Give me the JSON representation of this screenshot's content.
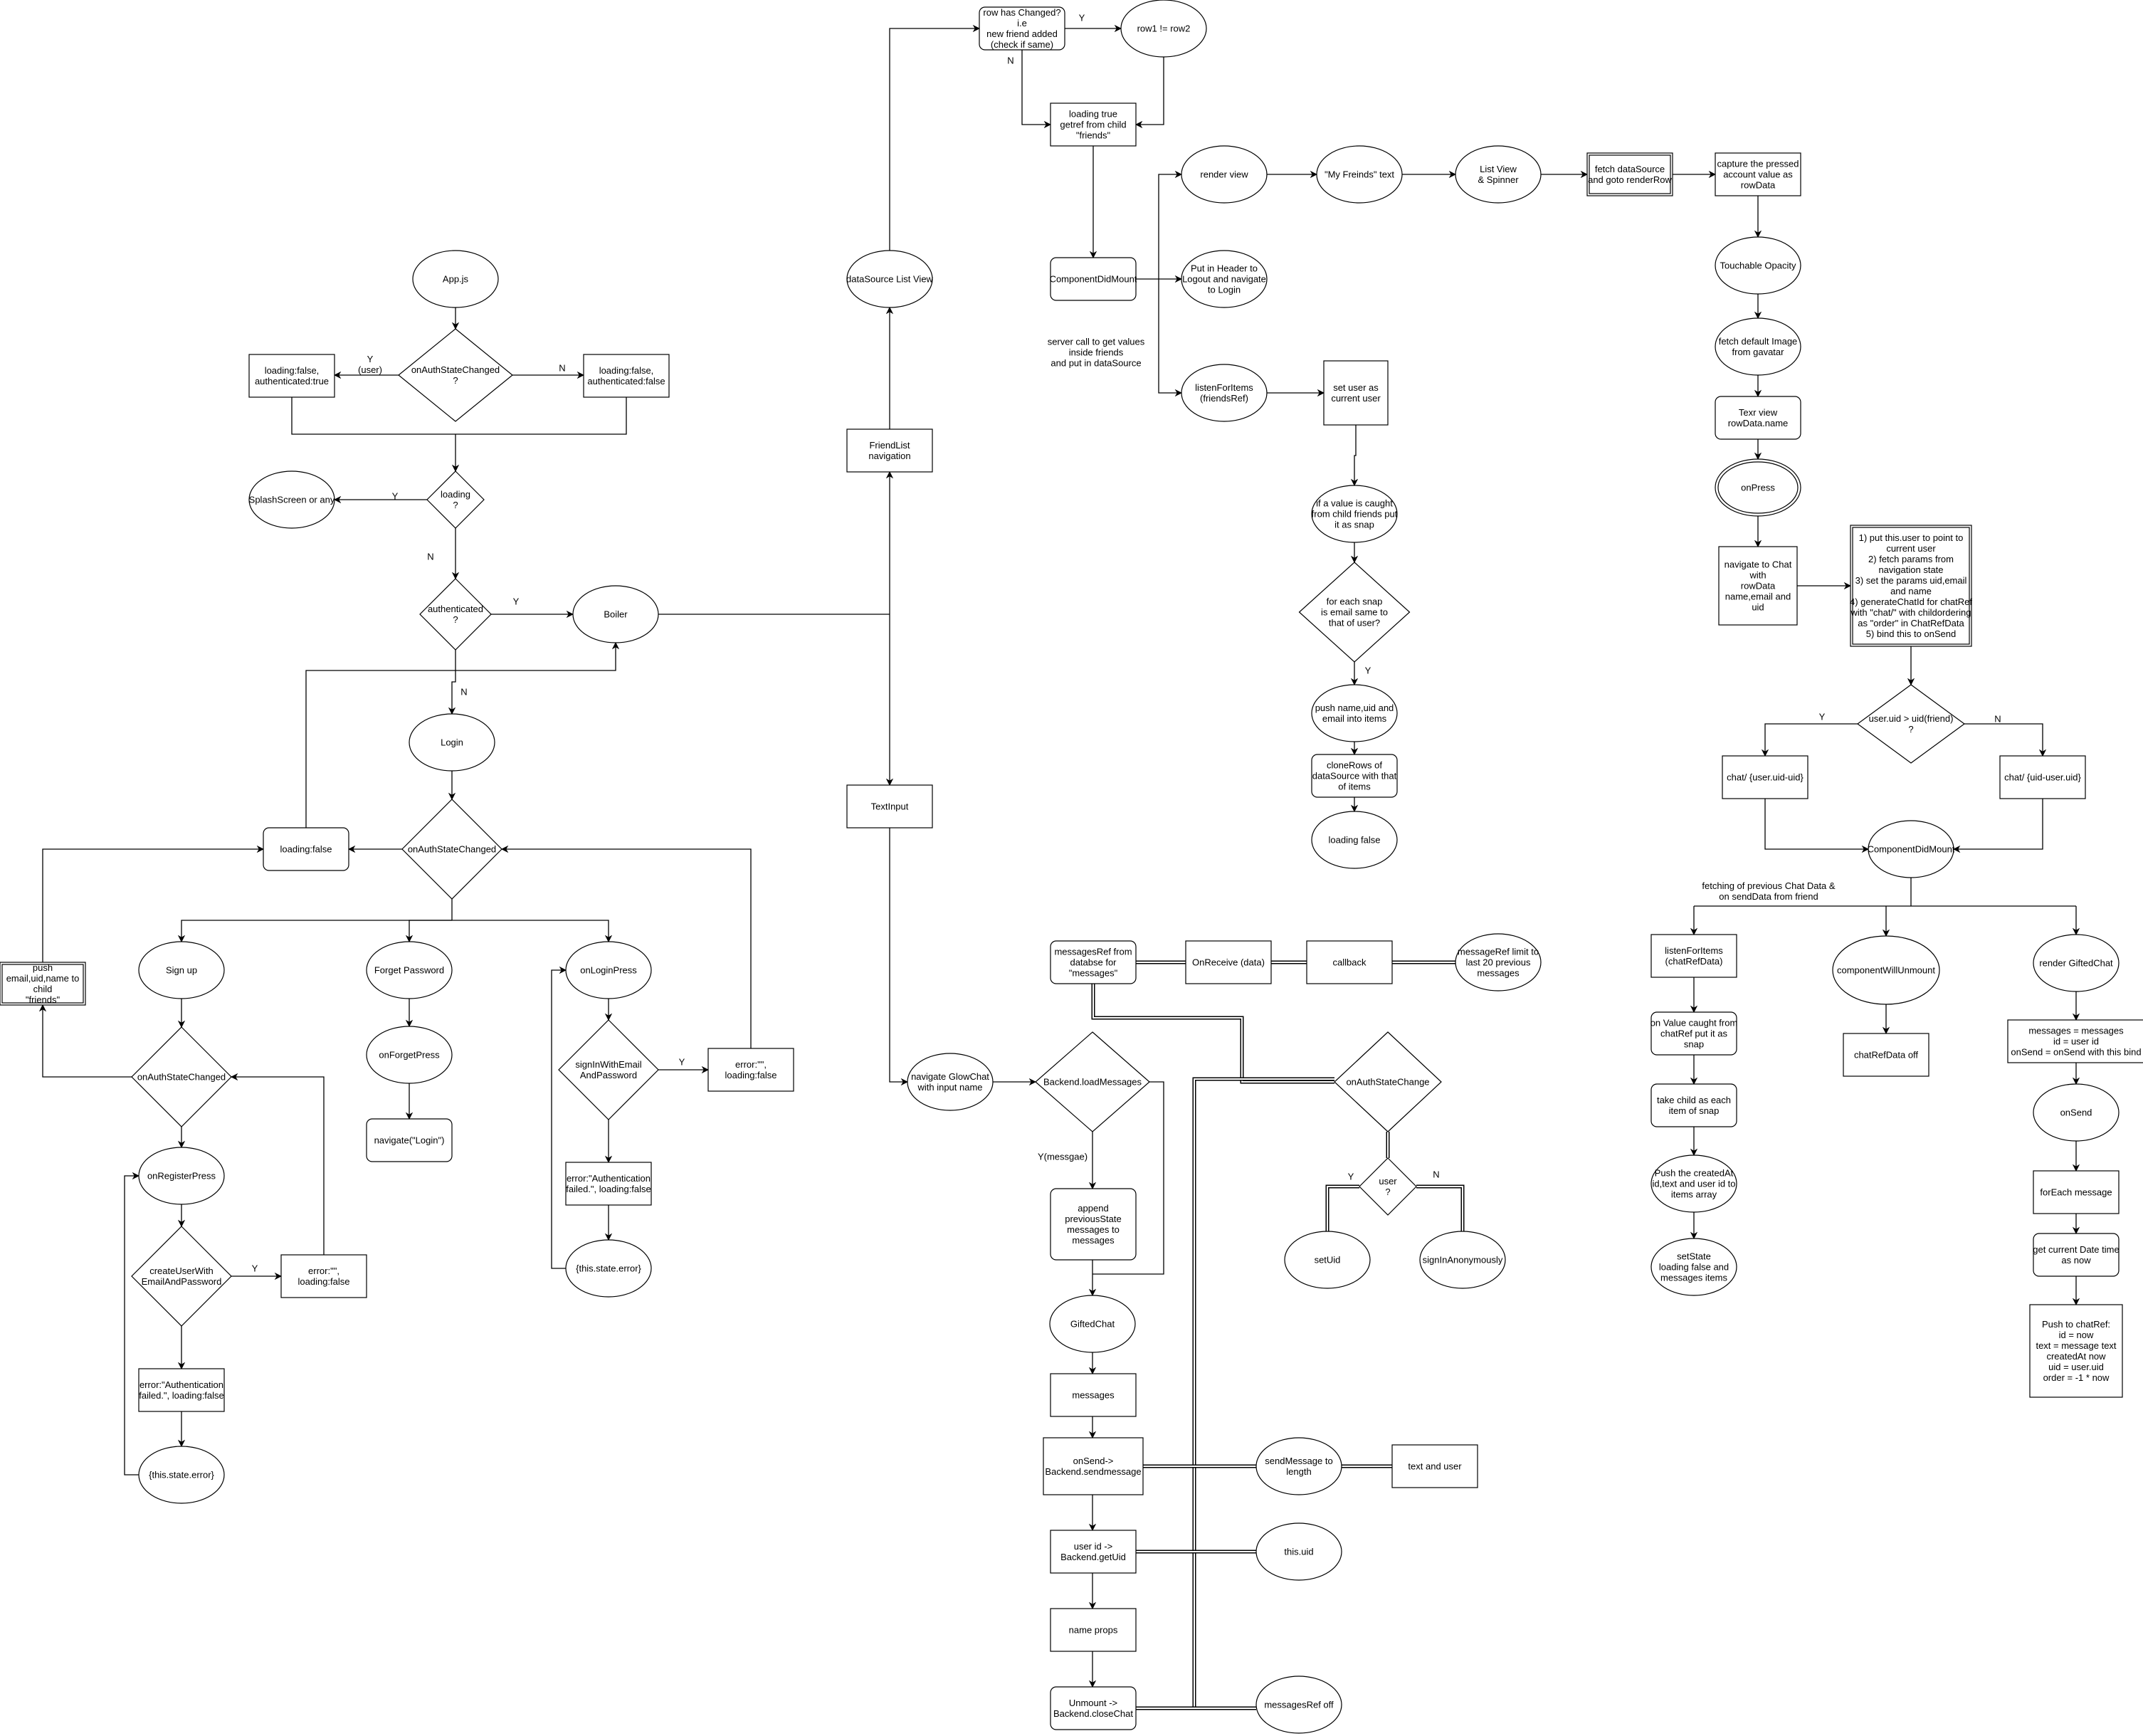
{
  "colors": {
    "stroke": "#000000",
    "background": "#ffffff"
  },
  "nodes": {
    "appjs": "App.js",
    "authq1": "onAuthStateChanged\n?",
    "lf_true": "loading:false,\nauthenticated:true",
    "lf_false": "loading:false,\nauthenticated:false",
    "loadingq": "loading\n?",
    "splash": "SplashScreen or any",
    "authenticatedq": "authenticated\n?",
    "boiler": "Boiler",
    "login": "Login",
    "auth2": "onAuthStateChanged",
    "loadingfalse": "loading:false",
    "signup": "Sign up",
    "forget": "Forget Password",
    "onlogin": "onLoginPress",
    "push": "push\nemail,uid,name to\nchild\n\"friends\"",
    "signupauth": "onAuthStateChanged",
    "onregister": "onRegisterPress",
    "createuser": "createUserWith\nEmailAndPassword",
    "err1": "error:\"\",\nloading:false",
    "authfail1": "error:\"Authentication\nfailed.\", loading:false",
    "thisstate1": "{this.state.error}",
    "onforget": "onForgetPress",
    "navlogin": "navigate(\"Login\")",
    "signin": "signInWithEmail\nAndPassword",
    "err2": "error:\"\",\nloading:false",
    "authfail2": "error:\"Authentication\nfailed.\", loading:false",
    "thisstate2": "{this.state.error}",
    "friendlist": "FriendList\nnavigation",
    "datasource": "dataSource List View",
    "rowchanged": "row has Changed?\ni.e\nnew friend added\n(check if same)",
    "row1": "row1 != row2",
    "loadingtrue": "loading true\ngetref from child\n\"friends\"",
    "cdm": "ComponentDidMount",
    "note1": "server call to get values\ninside friends\nand put in dataSource",
    "renderview": "render view",
    "putheader": "Put in Header to\nLogout and navigate\nto Login",
    "listen": "listenForItems\n(friendsRef)",
    "myfriends": "\"My Freinds\" text",
    "listview": "List View\n& Spinner",
    "fetchds": "fetch dataSource\nand goto renderRow",
    "capture": "capture the pressed\naccount value as\nrowData",
    "touchable": "Touchable Opacity",
    "fetchimg": "fetch default Image\nfrom gavatar",
    "texrview": "Texr view\nrowData.name",
    "onpress": "onPress",
    "navchat": "navigate to Chat\nwith\nrowData\nname,email and\nuid",
    "steps": "1) put this.user to point to\ncurrent user\n2) fetch params from\nnavigation state\n3) set the params uid,email\nand name\n4) generateChatId for chatRef\nwith \"chat/\" with childordering\nas \"order\" in ChatRefData\n5) bind this to onSend",
    "uidq": "user.uid > uid(friend)\n?",
    "chat1": "chat/ {user.uid-uid}",
    "chat2": "chat/ {uid-user.uid}",
    "cdm2": "ComponentDidMount",
    "note2": "fetching of previous Chat Data &\non sendData from friend",
    "listen2": "listenForItems\n(chatRefData)",
    "cwu": "componentWillUnmount",
    "rendergc": "render GiftedChat",
    "onvalue": "on Value caught from\nchatRef put it as\nsnap",
    "takechild": "take child as each\nitem of snap",
    "pushcreated": "Push the createdAt\nid,text and user id to\nitems array",
    "setstate": "setState\nloading false and\nmessages items",
    "chatrefoff": "chatRefData off",
    "msgassign": "messages = messages\nid = user id\nonSend = onSend with this bind",
    "onsend": "onSend",
    "foreach": "forEach message",
    "getdate": "get current Date  time\nas now",
    "pushchat": "Push to chatRef:\nid = now\ntext = message text\ncreatedAt now\nuid = user.uid\norder = -1 * now",
    "setuser": "set user as\ncurrent user",
    "ifvalue": "if a value is caught\nfrom child friends put\nit as snap",
    "foreachsnap": "for each snap\nis email same to\nthat of user?",
    "pushname": "push name,uid and\nemail into items",
    "clonerows": "cloneRows of\ndataSource with that\nof items",
    "loadingfalse2": "loading false",
    "textinput": "TextInput",
    "navglow": "navigate GlowChat\nwith input name",
    "msgref": "messagesRef from\ndatabse for\n\"messages\"",
    "onreceive": "OnReceive (data)",
    "callback": "callback",
    "msglimit": "messageRef limit to\nlast 20 previous\nmessages",
    "loadmsg": "Backend.loadMessages",
    "onauthchange": "onAuthStateChange",
    "userq": "user\n?",
    "setuid": "setUid",
    "signanon": "signInAnonymously",
    "append": "append\npreviousState\nmessages to\nmessages",
    "giftedchat": "GiftedChat",
    "messages": "messages",
    "onsendbk": "onSend->\nBackend.sendmessage",
    "getuid": "user id ->\nBackend.getUid",
    "nameprops": "name props",
    "unmount": "Unmount ->\nBackend.closeChat",
    "sendmsg": "sendMessage to\nlength",
    "textuser": "text and user",
    "thisuid": "this.uid",
    "msgrefoff": "messagesRef off"
  },
  "edge_labels": {
    "a1": "Y\n(user)",
    "a2": "N",
    "a3": "Y",
    "a4": "N",
    "a5": "Y",
    "a6": "N",
    "a7": "Y",
    "a8": "Y",
    "a9": "Y",
    "a10": "N",
    "a11": "Y",
    "a12": "Y(messgae)",
    "a13": "Y",
    "a14": "N",
    "a15": "Y",
    "a16": "N"
  }
}
